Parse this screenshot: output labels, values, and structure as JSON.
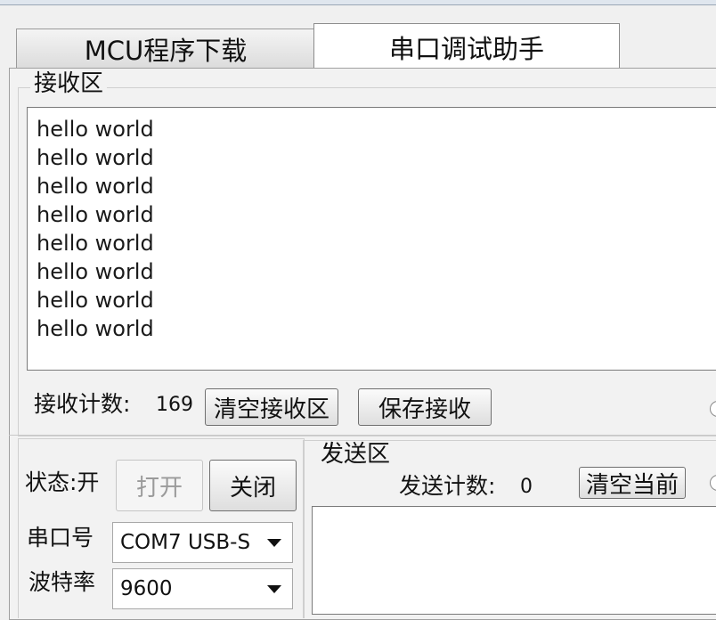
{
  "tabs": [
    {
      "label": "MCU程序下载",
      "active": false
    },
    {
      "label": "串口调试助手",
      "active": true
    }
  ],
  "receive": {
    "legend": "接收区",
    "lines": [
      "hello world",
      "hello world",
      "hello world",
      "hello world",
      "hello world",
      "hello world",
      "hello world",
      "hello world"
    ],
    "count_label": "接收计数:",
    "count_value": "169",
    "clear_button": "清空接收区",
    "save_button": "保存接收"
  },
  "port": {
    "status_label": "状态:开",
    "open_button": "打开",
    "close_button": "关闭",
    "port_label": "串口号",
    "port_value": "COM7  USB-S",
    "baud_label": "波特率",
    "baud_value": "9600"
  },
  "send": {
    "legend": "发送区",
    "count_label": "发送计数:",
    "count_value": "0",
    "clear_button": "清空当前",
    "input_value": ""
  },
  "colors": {
    "background": "#f0f0f0",
    "text_area": "#ffffff",
    "disabled_text": "#9a9a9a"
  },
  "icons": [
    "dropdown-arrow-icon",
    "radio-icon"
  ]
}
